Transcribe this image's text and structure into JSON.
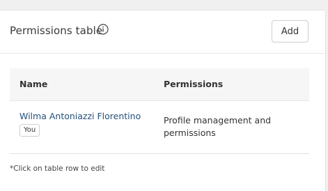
{
  "header": {
    "title": "Permissions table",
    "info_icon": "info-circle-icon",
    "add_label": "Add"
  },
  "table": {
    "columns": [
      "Name",
      "Permissions"
    ],
    "rows": [
      {
        "name": "Wilma Antoniazzi Florentino",
        "badge": "You",
        "permissions": "Profile management and permissions"
      }
    ]
  },
  "footer": {
    "note": "*Click on table row to edit"
  },
  "colors": {
    "link": "#24507a",
    "text": "#333333",
    "header_bg": "#f6f6f6",
    "border": "#e3e3e3"
  }
}
